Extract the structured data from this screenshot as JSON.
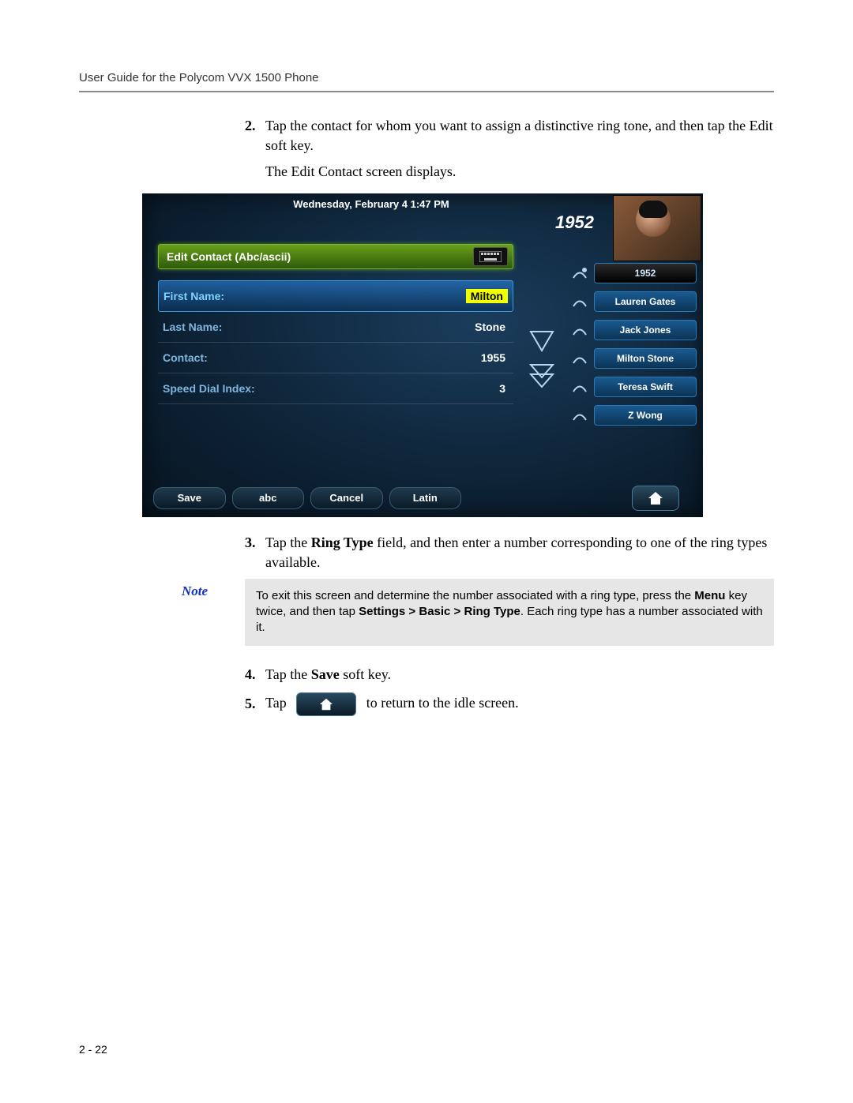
{
  "header": {
    "title": "User Guide for the Polycom VVX 1500 Phone"
  },
  "steps": {
    "s2": {
      "num": "2.",
      "text_a": "Tap the contact for whom you want to assign a distinctive ring tone, and then tap the Edit soft key.",
      "sub": "The Edit Contact screen displays."
    },
    "s3": {
      "num": "3.",
      "pre": "Tap the ",
      "bold": "Ring Type",
      "post": " field, and then enter a number corresponding to one of the ring types available."
    },
    "s4": {
      "num": "4.",
      "pre": "Tap the ",
      "bold": "Save",
      "post": " soft key."
    },
    "s5": {
      "num": "5.",
      "pre": "Tap",
      "post": "to return to the idle screen."
    }
  },
  "phone": {
    "status_bar": "Wednesday, February 4  1:47 PM",
    "extension": "1952",
    "panel_title": "Edit Contact (Abc/ascii)",
    "fields": [
      {
        "label": "First Name:",
        "value": "Milton",
        "active": true,
        "highlight": true
      },
      {
        "label": "Last Name:",
        "value": "Stone",
        "active": false,
        "highlight": false
      },
      {
        "label": "Contact:",
        "value": "1955",
        "active": false,
        "highlight": false
      },
      {
        "label": "Speed Dial Index:",
        "value": "3",
        "active": false,
        "highlight": false
      }
    ],
    "contacts": [
      {
        "label": "1952",
        "selected": true
      },
      {
        "label": "Lauren Gates",
        "selected": false
      },
      {
        "label": "Jack Jones",
        "selected": false
      },
      {
        "label": "Milton Stone",
        "selected": false
      },
      {
        "label": "Teresa Swift",
        "selected": false
      },
      {
        "label": "Z Wong",
        "selected": false
      }
    ],
    "softkeys": {
      "k1": "Save",
      "k2": "abc",
      "k3": "Cancel",
      "k4": "Latin"
    }
  },
  "note": {
    "label": "Note",
    "pre": "To exit this screen and determine the number associated with a ring type, press the ",
    "b1": "Menu",
    "mid1": " key twice, and then tap ",
    "b2": "Settings > Basic > Ring Type",
    "post": ". Each ring type has a number associated with it."
  },
  "page_num": "2 - 22"
}
